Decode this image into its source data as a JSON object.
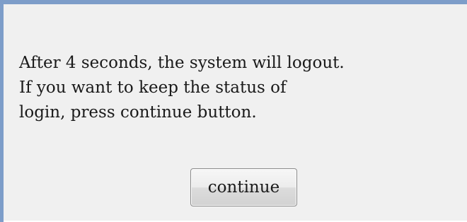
{
  "dialog": {
    "message_lines": [
      "After 4 seconds, the system will logout.",
      "If you want to keep the status of",
      "login, press continue button."
    ],
    "continue_label": "continue"
  },
  "colors": {
    "frame_border": "#7d9dc9",
    "background": "#f0f0f0",
    "text": "#1a1a1a"
  }
}
